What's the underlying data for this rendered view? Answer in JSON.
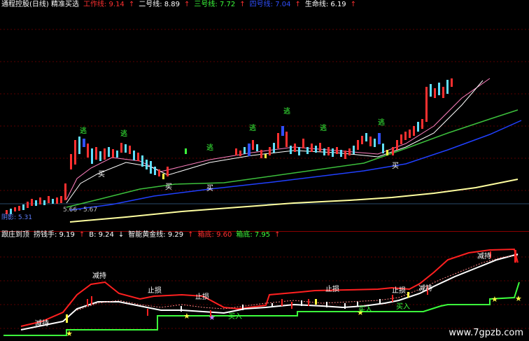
{
  "main": {
    "indicator_name": "通程控股(日线) 精准买选",
    "lines": [
      {
        "label": "工作线: 9.14",
        "color": "#ff3030",
        "arrow": "↑"
      },
      {
        "label": "二号线: 8.89",
        "color": "#ffffff",
        "arrow": "↑"
      },
      {
        "label": "三号线: 7.72",
        "color": "#3cff3c",
        "arrow": "↑"
      },
      {
        "label": "四号线: 7.04",
        "color": "#3050ff",
        "arrow": "↑"
      },
      {
        "label": "生命线: 6.19",
        "color": "#ffffff",
        "arrow": "↑"
      }
    ],
    "price_tag": "5.66 - 5.67",
    "low_tag": "阴影: 5.31",
    "escape_label": "逃",
    "buy_label": "买"
  },
  "sub": {
    "lines": [
      {
        "label": "跟庄到顶",
        "color": "#ffffff"
      },
      {
        "label": "捞钱手: 9.19",
        "color": "#ffffff",
        "arrow": "↑"
      },
      {
        "label": "B: 9.24",
        "color": "#ffffff",
        "arrow": "↓"
      },
      {
        "label": "智能黄金线: 9.29",
        "color": "#ffffff",
        "arrow": "↑"
      },
      {
        "label": "箱底: 9.60",
        "color": "#ff3030"
      },
      {
        "label": "箱底: 7.95",
        "color": "#3cff3c",
        "arrow": "↑"
      }
    ],
    "stop_label": "止损",
    "reduce_label": "减持",
    "buy_label": "买入"
  },
  "watermark": "www.7gpzb.com"
}
